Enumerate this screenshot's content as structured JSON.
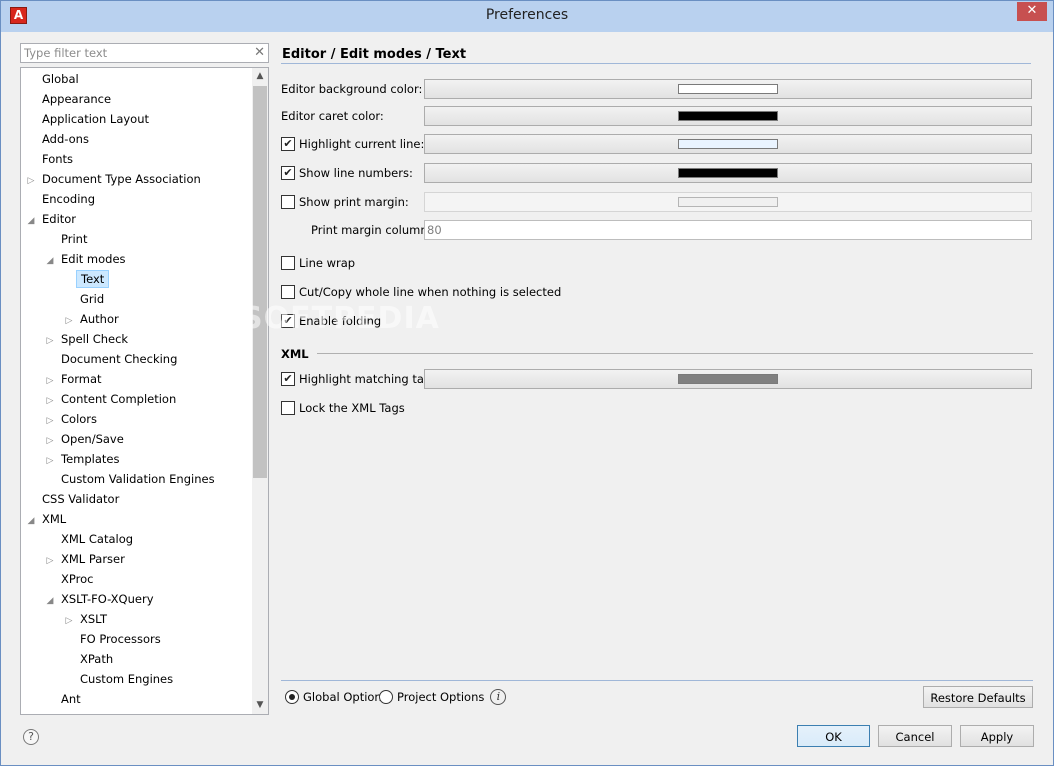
{
  "window": {
    "title": "Preferences",
    "close_glyph": "✕",
    "app_icon_letter": "A"
  },
  "filter": {
    "placeholder": "Type filter text",
    "value": "",
    "clear_glyph": "✕"
  },
  "tree": {
    "items": [
      {
        "label": "Global",
        "depth": 0,
        "expander": ""
      },
      {
        "label": "Appearance",
        "depth": 0,
        "expander": ""
      },
      {
        "label": "Application Layout",
        "depth": 0,
        "expander": ""
      },
      {
        "label": "Add-ons",
        "depth": 0,
        "expander": ""
      },
      {
        "label": "Fonts",
        "depth": 0,
        "expander": ""
      },
      {
        "label": "Document Type Association",
        "depth": 0,
        "expander": "collapsed"
      },
      {
        "label": "Encoding",
        "depth": 0,
        "expander": ""
      },
      {
        "label": "Editor",
        "depth": 0,
        "expander": "expanded"
      },
      {
        "label": "Print",
        "depth": 1,
        "expander": ""
      },
      {
        "label": "Edit modes",
        "depth": 1,
        "expander": "expanded"
      },
      {
        "label": "Text",
        "depth": 2,
        "expander": "",
        "selected": true
      },
      {
        "label": "Grid",
        "depth": 2,
        "expander": ""
      },
      {
        "label": "Author",
        "depth": 2,
        "expander": "collapsed"
      },
      {
        "label": "Spell Check",
        "depth": 1,
        "expander": "collapsed"
      },
      {
        "label": "Document Checking",
        "depth": 1,
        "expander": ""
      },
      {
        "label": "Format",
        "depth": 1,
        "expander": "collapsed"
      },
      {
        "label": "Content Completion",
        "depth": 1,
        "expander": "collapsed"
      },
      {
        "label": "Colors",
        "depth": 1,
        "expander": "collapsed"
      },
      {
        "label": "Open/Save",
        "depth": 1,
        "expander": "collapsed"
      },
      {
        "label": "Templates",
        "depth": 1,
        "expander": "collapsed"
      },
      {
        "label": "Custom Validation Engines",
        "depth": 1,
        "expander": ""
      },
      {
        "label": "CSS Validator",
        "depth": 0,
        "expander": ""
      },
      {
        "label": "XML",
        "depth": 0,
        "expander": "expanded"
      },
      {
        "label": "XML Catalog",
        "depth": 1,
        "expander": ""
      },
      {
        "label": "XML Parser",
        "depth": 1,
        "expander": "collapsed"
      },
      {
        "label": "XProc",
        "depth": 1,
        "expander": ""
      },
      {
        "label": "XSLT-FO-XQuery",
        "depth": 1,
        "expander": "expanded"
      },
      {
        "label": "XSLT",
        "depth": 2,
        "expander": "collapsed"
      },
      {
        "label": "FO Processors",
        "depth": 2,
        "expander": ""
      },
      {
        "label": "XPath",
        "depth": 2,
        "expander": ""
      },
      {
        "label": "Custom Engines",
        "depth": 2,
        "expander": ""
      },
      {
        "label": "Ant",
        "depth": 1,
        "expander": ""
      }
    ]
  },
  "page": {
    "title": "Editor / Edit modes / Text",
    "bg_color_label": "Editor background color:",
    "bg_color": "#ffffff",
    "caret_color_label": "Editor caret color:",
    "caret_color": "#000000",
    "highlight_line": {
      "label": "Highlight current line:",
      "checked": true,
      "color": "#eaf4ff"
    },
    "line_numbers": {
      "label": "Show line numbers:",
      "checked": true,
      "color": "#000000"
    },
    "print_margin": {
      "label": "Show print margin:",
      "checked": false,
      "color": "#f0f0f0"
    },
    "print_margin_column": {
      "label": "Print margin column:",
      "value": "80"
    },
    "line_wrap": {
      "label": "Line wrap",
      "checked": false
    },
    "cut_copy": {
      "label": "Cut/Copy whole line when nothing is selected",
      "checked": false
    },
    "folding": {
      "label": "Enable folding",
      "checked": true
    },
    "xml_section": "XML",
    "highlight_tag": {
      "label": "Highlight matching tag:",
      "checked": true,
      "color": "#808080"
    },
    "lock_xml": {
      "label": "Lock the XML Tags",
      "checked": false
    }
  },
  "options": {
    "global_label": "Global Options",
    "global_checked": true,
    "project_label": "Project Options",
    "project_checked": false,
    "info_glyph": "i"
  },
  "buttons": {
    "restore": "Restore Defaults",
    "ok": "OK",
    "cancel": "Cancel",
    "apply": "Apply",
    "help_glyph": "?"
  },
  "watermark": "SOFTPEDIA"
}
